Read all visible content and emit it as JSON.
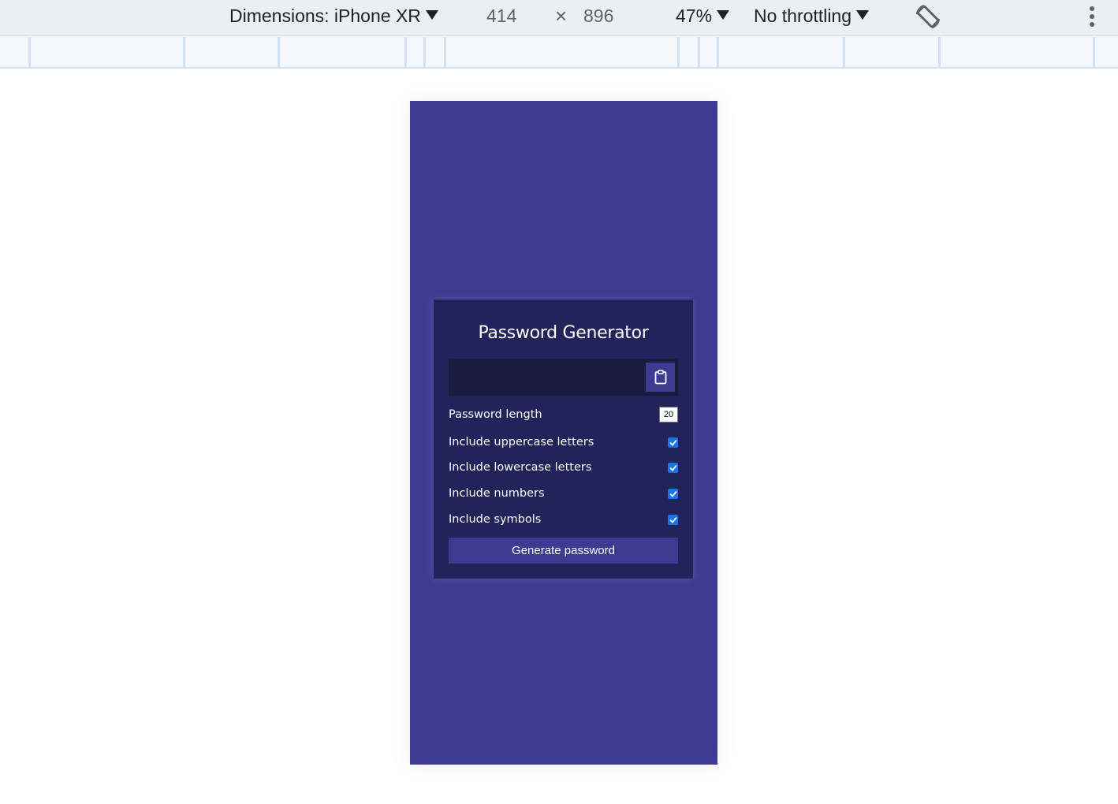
{
  "devtools": {
    "device_label": "Dimensions: iPhone XR",
    "width": "414",
    "times": "×",
    "height": "896",
    "zoom": "47%",
    "throttling": "No throttling"
  },
  "app": {
    "title": "Password Generator",
    "result_value": "",
    "settings": [
      {
        "label": "Password length",
        "type": "number",
        "value": "20"
      },
      {
        "label": "Include uppercase letters",
        "type": "checkbox",
        "checked": true
      },
      {
        "label": "Include lowercase letters",
        "type": "checkbox",
        "checked": true
      },
      {
        "label": "Include numbers",
        "type": "checkbox",
        "checked": true
      },
      {
        "label": "Include symbols",
        "type": "checkbox",
        "checked": true
      }
    ],
    "generate_label": "Generate password"
  },
  "colors": {
    "viewport_bg": "#3b3b91",
    "card_bg": "#23235b",
    "result_bg": "#1b1b3f",
    "checkbox": "#1a73e8"
  }
}
